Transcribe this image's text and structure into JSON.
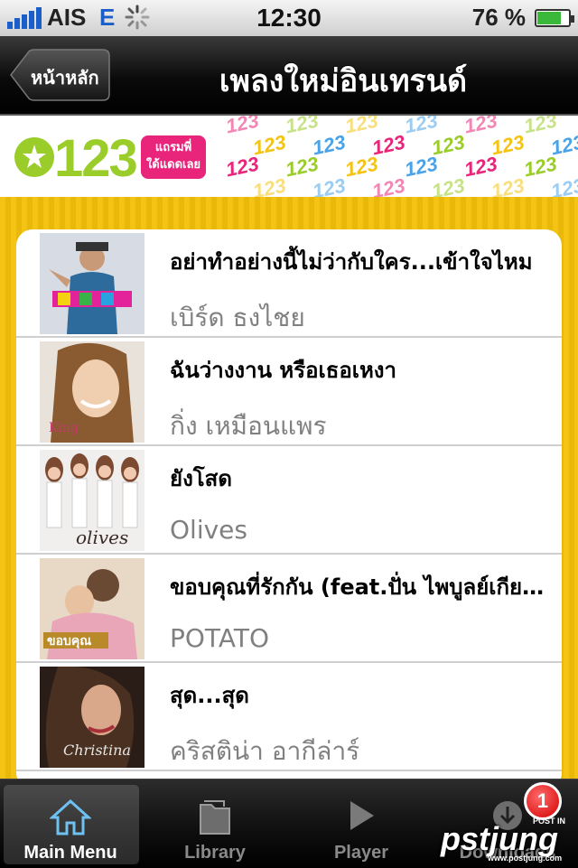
{
  "status_bar": {
    "carrier": "AIS",
    "network": "E",
    "time": "12:30",
    "battery": "76 %",
    "battery_level": 0.76
  },
  "navbar": {
    "back_label": "หน้าหลัก",
    "title": "เพลงใหม่อินเทรนด์"
  },
  "banner": {
    "logo_text": "123",
    "tagline_line1": "แถรมพี่",
    "tagline_line2": "ใด้แดดเลย",
    "pattern_text": "123",
    "colors": {
      "green": "#9acc2a",
      "pink": "#e8257a",
      "yellow": "#f3c414",
      "blue": "#4aa3e8"
    }
  },
  "songs": [
    {
      "title": "อย่าทำอย่างนี้ไม่ว่ากับใคร...เข้าใจไหม",
      "artist": "เบิร์ด ธงไชย"
    },
    {
      "title": "ฉันว่างงาน หรือเธอเหงา",
      "artist": "กิ่ง เหมือนแพร"
    },
    {
      "title": "ยังโสด",
      "artist": "Olives"
    },
    {
      "title": "ขอบคุณที่รักกัน (feat.ปั่น ไพบูลย์เกียรติ)",
      "artist": "POTATO"
    },
    {
      "title": "สุด...สุด",
      "artist": "คริสติน่า อากีล่าร์"
    }
  ],
  "tabs": [
    {
      "label": "Main Menu",
      "icon": "home-icon",
      "active": true
    },
    {
      "label": "Library",
      "icon": "folder-icon",
      "active": false
    },
    {
      "label": "Player",
      "icon": "play-icon",
      "active": false
    },
    {
      "label": "Downloads",
      "icon": "download-icon",
      "active": false
    }
  ],
  "badge": {
    "count": "1"
  },
  "watermark": {
    "brand": "pstjung",
    "tag": "POST IN",
    "url": "www.postjung.com"
  }
}
